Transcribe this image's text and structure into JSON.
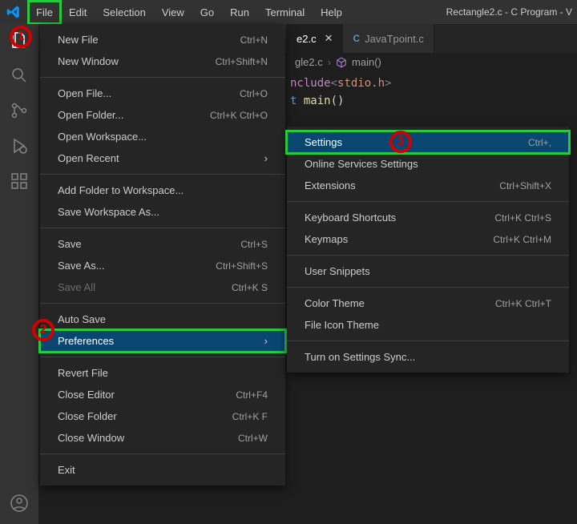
{
  "titlebar": {
    "menus": [
      "File",
      "Edit",
      "Selection",
      "View",
      "Go",
      "Run",
      "Terminal",
      "Help"
    ],
    "title": "Rectangle2.c - C Program - V"
  },
  "tabs": {
    "active": "e2.c",
    "inactive": "JavaTpoint.c"
  },
  "breadcrumb": {
    "file": "gle2.c",
    "symbol": "main()"
  },
  "code": {
    "line1_include": "nclude",
    "line1_header": "stdio.h",
    "line2_type": "t",
    "line2_fn": "main",
    "line2_paren": "()"
  },
  "file_menu": {
    "new_file": {
      "label": "New File",
      "kbd": "Ctrl+N"
    },
    "new_window": {
      "label": "New Window",
      "kbd": "Ctrl+Shift+N"
    },
    "open_file": {
      "label": "Open File...",
      "kbd": "Ctrl+O"
    },
    "open_folder": {
      "label": "Open Folder...",
      "kbd": "Ctrl+K Ctrl+O"
    },
    "open_workspace": {
      "label": "Open Workspace...",
      "kbd": ""
    },
    "open_recent": {
      "label": "Open Recent",
      "kbd": ""
    },
    "add_folder": {
      "label": "Add Folder to Workspace...",
      "kbd": ""
    },
    "save_workspace_as": {
      "label": "Save Workspace As...",
      "kbd": ""
    },
    "save": {
      "label": "Save",
      "kbd": "Ctrl+S"
    },
    "save_as": {
      "label": "Save As...",
      "kbd": "Ctrl+Shift+S"
    },
    "save_all": {
      "label": "Save All",
      "kbd": "Ctrl+K S"
    },
    "auto_save": {
      "label": "Auto Save",
      "kbd": ""
    },
    "preferences": {
      "label": "Preferences",
      "kbd": ""
    },
    "revert_file": {
      "label": "Revert File",
      "kbd": ""
    },
    "close_editor": {
      "label": "Close Editor",
      "kbd": "Ctrl+F4"
    },
    "close_folder": {
      "label": "Close Folder",
      "kbd": "Ctrl+K F"
    },
    "close_window": {
      "label": "Close Window",
      "kbd": "Ctrl+W"
    },
    "exit": {
      "label": "Exit",
      "kbd": ""
    }
  },
  "sub_menu": {
    "settings": {
      "label": "Settings",
      "kbd": "Ctrl+,"
    },
    "online_services": {
      "label": "Online Services Settings",
      "kbd": ""
    },
    "extensions": {
      "label": "Extensions",
      "kbd": "Ctrl+Shift+X"
    },
    "keyboard_shortcuts": {
      "label": "Keyboard Shortcuts",
      "kbd": "Ctrl+K Ctrl+S"
    },
    "keymaps": {
      "label": "Keymaps",
      "kbd": "Ctrl+K Ctrl+M"
    },
    "user_snippets": {
      "label": "User Snippets",
      "kbd": ""
    },
    "color_theme": {
      "label": "Color Theme",
      "kbd": "Ctrl+K Ctrl+T"
    },
    "file_icon_theme": {
      "label": "File Icon Theme",
      "kbd": ""
    },
    "settings_sync": {
      "label": "Turn on Settings Sync...",
      "kbd": ""
    }
  },
  "annotations": {
    "a1": "1",
    "a2": "2",
    "a3": "3"
  }
}
